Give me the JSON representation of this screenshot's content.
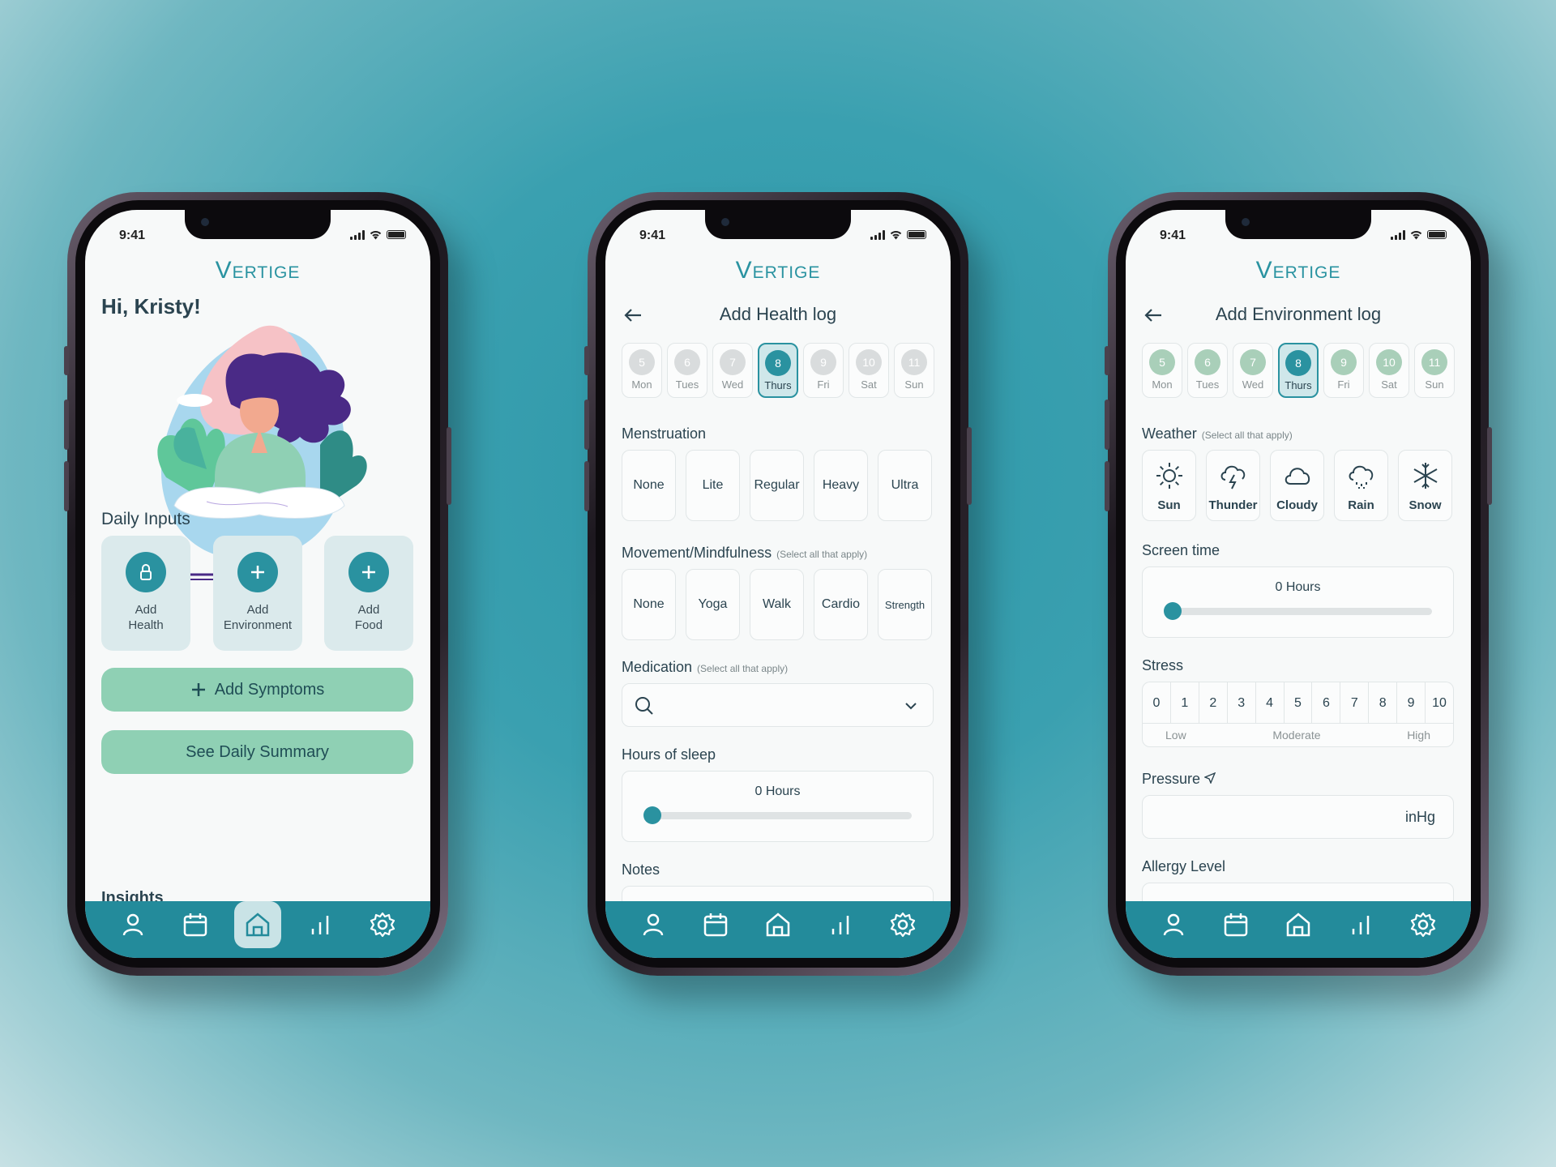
{
  "status": {
    "time": "9:41"
  },
  "brand": "Vertige",
  "home": {
    "greeting": "Hi, Kristy!",
    "daily_inputs_title": "Daily Inputs",
    "cards": [
      {
        "line1": "Add",
        "line2": "Health",
        "icon": "lock-icon"
      },
      {
        "line1": "Add",
        "line2": "Environment",
        "icon": "plus-icon"
      },
      {
        "line1": "Add",
        "line2": "Food",
        "icon": "plus-icon"
      }
    ],
    "add_symptoms": "Add Symptoms",
    "daily_summary": "See Daily Summary",
    "insights": "Insights"
  },
  "days": [
    {
      "num": "5",
      "label": "Mon"
    },
    {
      "num": "6",
      "label": "Tues"
    },
    {
      "num": "7",
      "label": "Wed"
    },
    {
      "num": "8",
      "label": "Thurs",
      "selected": true
    },
    {
      "num": "9",
      "label": "Fri"
    },
    {
      "num": "10",
      "label": "Sat"
    },
    {
      "num": "11",
      "label": "Sun"
    }
  ],
  "health": {
    "title": "Add Health log",
    "menstruation_label": "Menstruation",
    "menstruation": [
      "None",
      "Lite",
      "Regular",
      "Heavy",
      "Ultra"
    ],
    "movement_label": "Movement/Mindfulness",
    "select_hint": "(Select all that apply)",
    "movement": [
      "None",
      "Yoga",
      "Walk",
      "Cardio",
      "Strength"
    ],
    "medication_label": "Medication",
    "sleep_label": "Hours of sleep",
    "sleep_value": "0 Hours",
    "notes_label": "Notes"
  },
  "environment": {
    "title": "Add Environment log",
    "weather_label": "Weather",
    "select_hint": "(Select all that apply)",
    "weather": [
      {
        "label": "Sun",
        "icon": "sun-icon"
      },
      {
        "label": "Thunder",
        "icon": "thunder-icon"
      },
      {
        "label": "Cloudy",
        "icon": "cloud-icon"
      },
      {
        "label": "Rain",
        "icon": "rain-icon"
      },
      {
        "label": "Snow",
        "icon": "snowflake-icon"
      }
    ],
    "screen_label": "Screen time",
    "screen_value": "0 Hours",
    "stress_label": "Stress",
    "stress_values": [
      "0",
      "1",
      "2",
      "3",
      "4",
      "5",
      "6",
      "7",
      "8",
      "9",
      "10"
    ],
    "stress_scale": [
      "Low",
      "Moderate",
      "High"
    ],
    "pressure_label": "Pressure",
    "pressure_unit": "inHg",
    "allergy_label": "Allergy Level"
  },
  "colors": {
    "primary": "#238b9b",
    "accent": "#8fd0b4",
    "background": "#f7f9f9"
  }
}
